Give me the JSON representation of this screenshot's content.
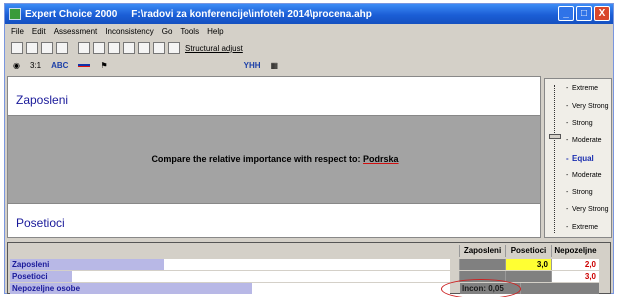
{
  "window": {
    "app_name": "Expert Choice 2000",
    "file_path": "F:\\radovi za konferencije\\infoteh 2014\\procena.ahp",
    "min_label": "_",
    "max_label": "□",
    "close_label": "X"
  },
  "menu": [
    "File",
    "Edit",
    "Assessment",
    "Inconsistency",
    "Go",
    "Tools",
    "Help"
  ],
  "toolbar": {
    "structural_adjust_label": "Structural adjust"
  },
  "toolbar2": {
    "ratio_label": "3:1",
    "abc_label": "ABC",
    "yhh_label": "YHH"
  },
  "comparison": {
    "top_item": "Zaposleni",
    "bottom_item": "Posetioci",
    "prompt": "Compare the relative importance  with respect to:",
    "topic": "Podrska"
  },
  "scale": {
    "items": [
      "Extreme",
      "Very Strong",
      "Strong",
      "Moderate",
      "Equal",
      "Moderate",
      "Strong",
      "Very Strong",
      "Extreme"
    ],
    "equal_index": 4
  },
  "matrix": {
    "columns": [
      "Zaposleni",
      "Posetioci",
      "Nepozeljne"
    ],
    "rows": [
      {
        "name": "Zaposleni",
        "fill": 0.35,
        "cells": [
          "",
          "3,0",
          "2,0"
        ]
      },
      {
        "name": "Posetioci",
        "fill": 0.14,
        "cells": [
          "",
          "",
          "3,0"
        ]
      },
      {
        "name": "Nepozeljne osobe",
        "fill": 0.55,
        "cells": [
          "",
          "",
          ""
        ]
      }
    ],
    "inconsistency": "Incon: 0,05"
  },
  "colors": {
    "title_bar": "#1b5ed6",
    "label_blue": "#1a1a9a",
    "highlight": "#ffff33",
    "value_red": "#c00000"
  }
}
